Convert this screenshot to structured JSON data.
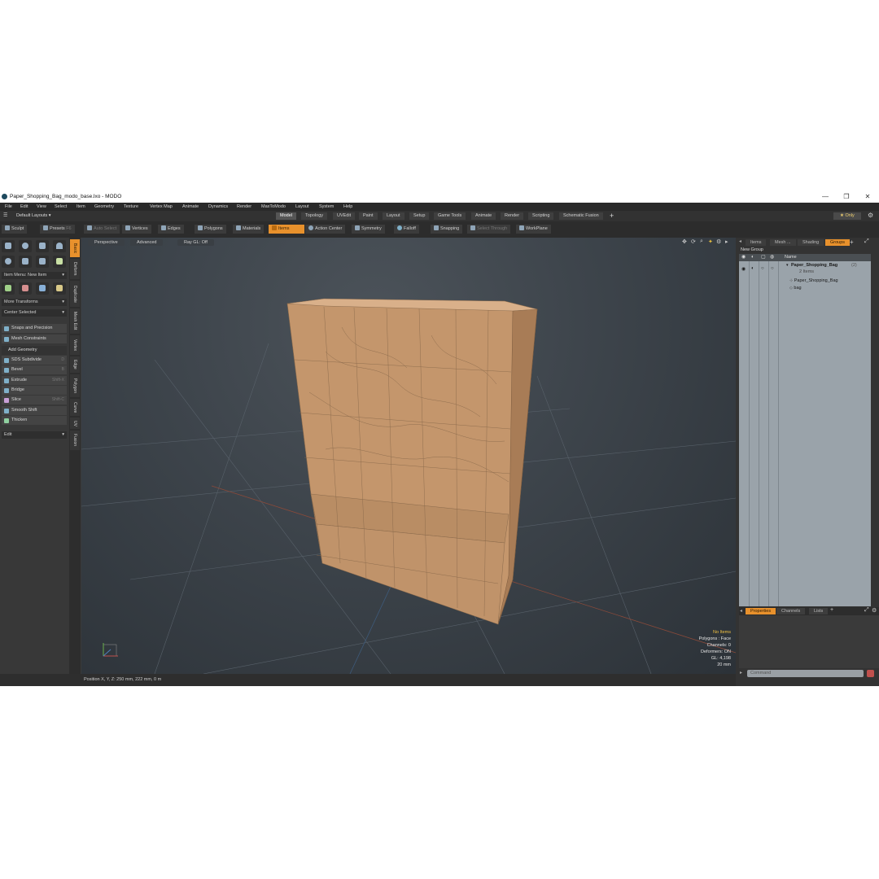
{
  "window": {
    "title": "Paper_Shopping_Bag_modo_base.lxo - MODO",
    "controls": [
      "—",
      "❐",
      "✕"
    ]
  },
  "menu": [
    "File",
    "Edit",
    "View",
    "Select",
    "Item",
    "Geometry",
    "Texture",
    "Vertex Map",
    "Animate",
    "Dynamics",
    "Render",
    "MaxToModo",
    "Layout",
    "System",
    "Help"
  ],
  "layout_bar": {
    "layout_label": "Default Layouts ▾",
    "tabs": [
      "Model",
      "Topology",
      "UVEdit",
      "Paint",
      "Layout",
      "Setup",
      "Game Tools",
      "Animate",
      "Render",
      "Scripting",
      "Schematic Fusion"
    ],
    "active_tab": "Model",
    "add": "+",
    "only_label": "★ Only"
  },
  "toolbar": {
    "sculpt": "Sculpt",
    "presets": "Presets",
    "presets_shortcut": "F6",
    "auto_select": "Auto Select",
    "vertices": "Vertices",
    "edges": "Edges",
    "polygons": "Polygons",
    "materials": "Materials",
    "items": "Items",
    "action_center": "Action Center",
    "symmetry": "Symmetry",
    "falloff": "Falloff",
    "snapping": "Snapping",
    "select_through": "Select Through",
    "workplane": "WorkPlane"
  },
  "left_panel": {
    "item_menu": "Item Menu: New Item",
    "more_transforms": "More Transforms",
    "center_selected": "Center Selected",
    "snaps": "Snaps and Precision",
    "mesh_constraints": "Mesh Constraints",
    "add_geometry": "Add Geometry",
    "tools": [
      {
        "label": "SDS Subdivide",
        "shortcut": "D"
      },
      {
        "label": "Bevel",
        "shortcut": "B"
      },
      {
        "label": "Extrude",
        "shortcut": "Shift-X"
      },
      {
        "label": "Bridge",
        "shortcut": ""
      },
      {
        "label": "Slice",
        "shortcut": "Shift-C"
      },
      {
        "label": "Smooth Shift",
        "shortcut": ""
      },
      {
        "label": "Thicken",
        "shortcut": ""
      }
    ],
    "edit": "Edit"
  },
  "vertical_tabs": [
    "Basic",
    "Deform",
    "Duplicate",
    "Mesh Edit",
    "Vertex",
    "Edge",
    "Polygon",
    "Curve",
    "UV",
    "Fusion"
  ],
  "viewport": {
    "perspective": "Perspective",
    "advanced": "Advanced",
    "raygl": "Ray GL: Off",
    "info": {
      "no_items": "No Items",
      "polygons": "Polygons : Face",
      "channels": "Channels: 0",
      "deformers": "Deformers: ON",
      "gl": "GL: 4,198",
      "unit": "20 mm"
    }
  },
  "status": {
    "position": "Position X, Y, Z:   250 mm, 222 mm, 0 m"
  },
  "right_panel": {
    "tabs": [
      "Items",
      "Mesh ...",
      "Shading",
      "Groups"
    ],
    "active_tab": "Groups",
    "new_group": "New Group",
    "name_header": "Name",
    "group_name": "Paper_Shopping_Bag",
    "group_count": "(2)",
    "group_items": "2 Items",
    "children": [
      "Paper_Shopping_Bag",
      "bag"
    ],
    "bottom_tabs": [
      "Properties",
      "Channels",
      "Lists"
    ],
    "bottom_active": "Properties",
    "command_placeholder": "Command"
  },
  "colors": {
    "accent": "#e8912c",
    "bag": "#c99a6e",
    "viewport_bg": "#3e454c"
  }
}
